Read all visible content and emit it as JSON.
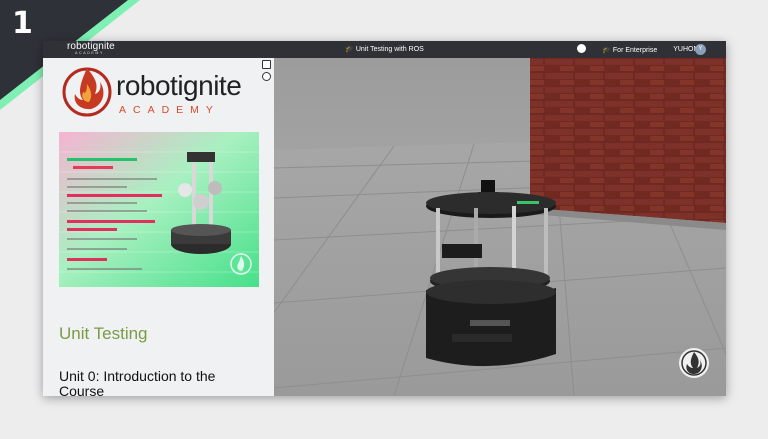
{
  "corner_badge": {
    "number": "1"
  },
  "topbar": {
    "brand_main": "robotignite",
    "brand_sub": "ACADEMY",
    "course_link": "Unit Testing with ROS",
    "enterprise_link": "For Enterprise",
    "user_name": "YUHONG",
    "avatar_initial": "Y"
  },
  "left_panel": {
    "logo_word_robot": "robot",
    "logo_word_ignite": "ignite",
    "logo_sub": "ACADEMY",
    "course_title": "Unit Testing",
    "unit_title": "Unit 0: Introduction to the Course"
  },
  "colors": {
    "topbar": "#2f3136",
    "course_title": "#7a9b45",
    "logo_accent": "#d64a2a",
    "badge_border": "#6ee7a8"
  },
  "icons": [
    "globe-icon",
    "graduation-cap-icon",
    "fullscreen-icon",
    "refresh-icon",
    "flame-logo-icon"
  ]
}
